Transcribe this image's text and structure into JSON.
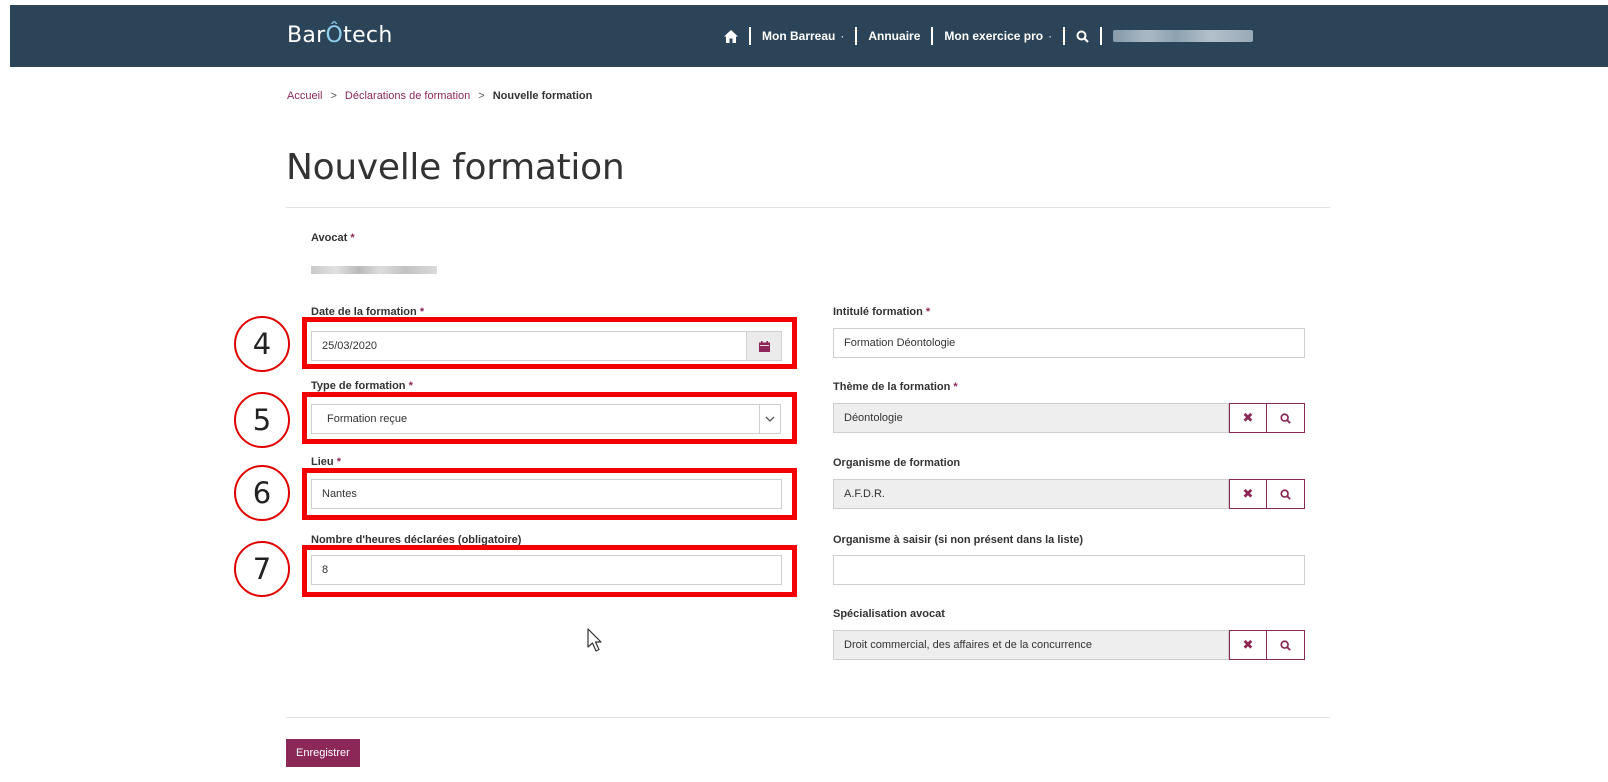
{
  "header": {
    "logo_prefix": "Bar",
    "logo_accent": "Ô",
    "logo_suffix": "tech",
    "nav": {
      "home_icon": "home-icon",
      "mon_barreau": "Mon Barreau",
      "annuaire": "Annuaire",
      "mon_exercice_pro": "Mon exercice pro",
      "dropdown_caret": "·",
      "search_icon": "search-icon"
    }
  },
  "breadcrumb": {
    "home": "Accueil",
    "separator": ">",
    "declarations": "Déclarations de formation",
    "current": "Nouvelle formation"
  },
  "page_title": "Nouvelle formation",
  "form": {
    "avocat": {
      "label": "Avocat",
      "required_mark": "*"
    },
    "date": {
      "label": "Date de la formation",
      "required_mark": "*",
      "value": "25/03/2020",
      "icon": "calendar-icon"
    },
    "type": {
      "label": "Type de formation",
      "required_mark": "*",
      "value": "Formation reçue"
    },
    "lieu": {
      "label": "Lieu",
      "required_mark": "*",
      "value": "Nantes"
    },
    "heures": {
      "label": "Nombre d'heures déclarées (obligatoire)",
      "value": "8"
    },
    "intitule": {
      "label": "Intitulé formation",
      "required_mark": "*",
      "value": "Formation Déontologie"
    },
    "theme": {
      "label": "Thème de la formation",
      "required_mark": "*",
      "value": "Déontologie"
    },
    "organisme": {
      "label": "Organisme de formation",
      "value": "A.F.D.R."
    },
    "organisme_saisir": {
      "label": "Organisme à saisir (si non présent dans la liste)",
      "value": ""
    },
    "specialisation": {
      "label": "Spécialisation avocat",
      "value": "Droit commercial, des affaires et de la concurrence"
    },
    "save_label": "Enregistrer"
  },
  "markers": [
    "4",
    "5",
    "6",
    "7"
  ],
  "colors": {
    "header_bg": "#2b4457",
    "accent": "#8b2858",
    "highlight": "#f20000"
  }
}
